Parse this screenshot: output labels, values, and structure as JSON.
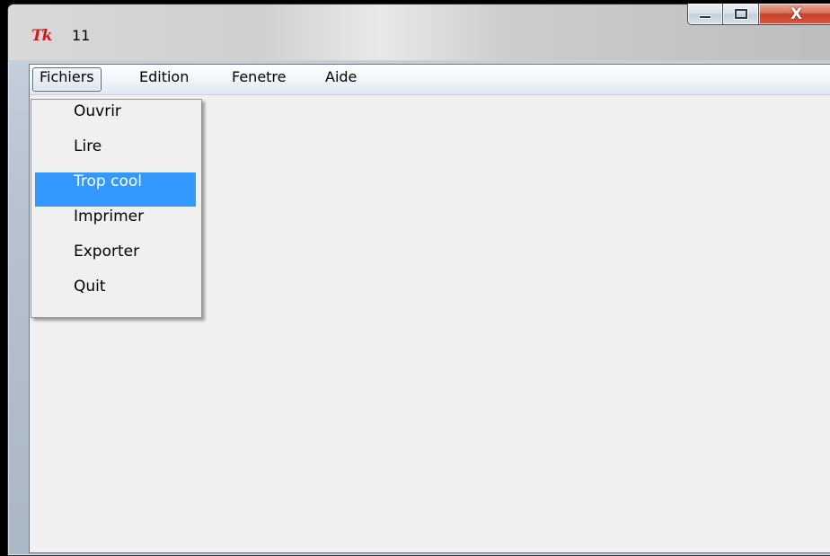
{
  "window": {
    "title": "11",
    "app_icon": "Tk",
    "icons": {
      "app": "tk-feather-icon",
      "minimize": "minimize-icon",
      "maximize": "maximize-icon",
      "close": "close-icon"
    },
    "caption": {
      "close_glyph": "X"
    }
  },
  "menubar": {
    "items": [
      {
        "label": "Fichiers",
        "active": true
      },
      {
        "label": "Edition"
      },
      {
        "label": "Fenetre"
      },
      {
        "label": "Aide"
      }
    ]
  },
  "dropdown": {
    "items": [
      {
        "label": "Ouvrir"
      },
      {
        "label": "Lire"
      },
      {
        "label": "Trop cool",
        "highlighted": true
      },
      {
        "label": "Imprimer"
      },
      {
        "label": "Exporter"
      },
      {
        "label": "Quit"
      }
    ]
  },
  "colors": {
    "highlight": "#3399ff",
    "close_button": "#c7412a",
    "client_bg": "#f0f0f0"
  }
}
